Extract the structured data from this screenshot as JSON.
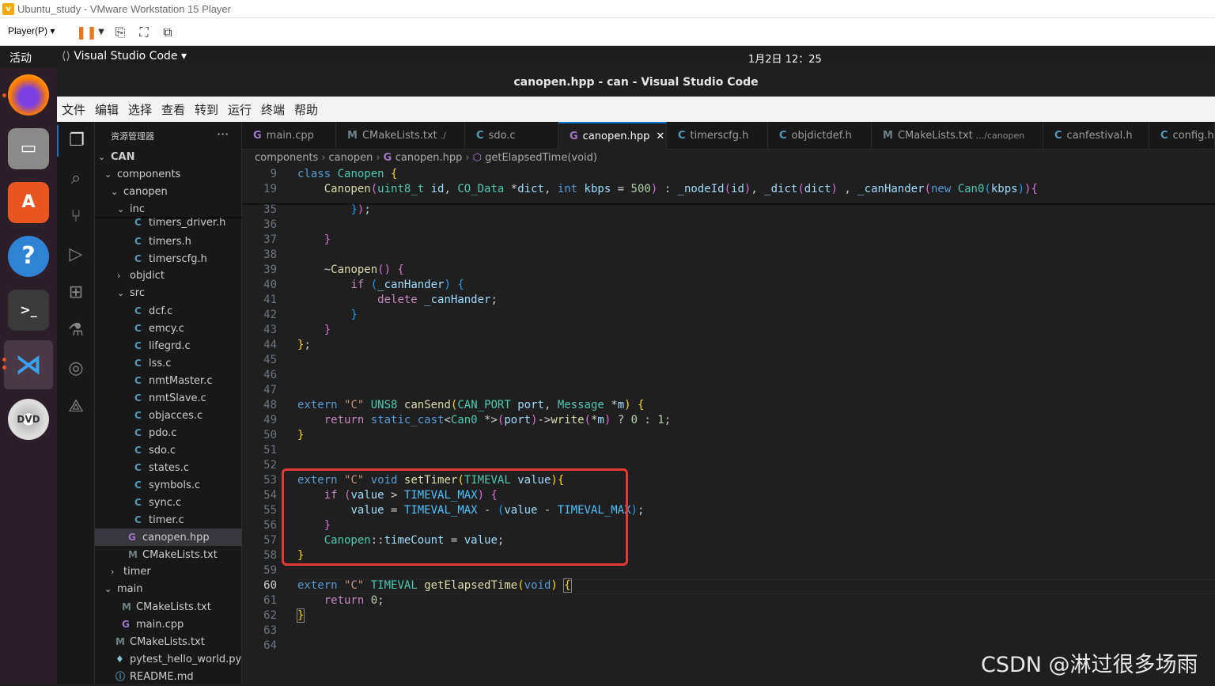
{
  "vm": {
    "title": "Ubuntu_study - VMware Workstation 15 Player",
    "player_menu": "Player(P)"
  },
  "gnome": {
    "activities": "活动",
    "app_name": "Visual Studio Code",
    "clock": "1月2日  12：25"
  },
  "vscode": {
    "title": "canopen.hpp - can - Visual Studio Code",
    "menu": [
      "文件",
      "编辑",
      "选择",
      "查看",
      "转到",
      "运行",
      "终端",
      "帮助"
    ]
  },
  "sidebar": {
    "header": "资源管理器",
    "more": "···",
    "tree": [
      {
        "label": "CAN",
        "depth": 0,
        "chev": "v",
        "icon": ""
      },
      {
        "label": "components",
        "depth": 1,
        "chev": "v",
        "icon": ""
      },
      {
        "label": "canopen",
        "depth": 2,
        "chev": "v",
        "icon": ""
      },
      {
        "label": "inc",
        "depth": 3,
        "chev": "v",
        "icon": ""
      },
      {
        "label": "timers_driver.h",
        "depth": 4,
        "chev": "",
        "icon": "C"
      },
      {
        "label": "timers.h",
        "depth": 4,
        "chev": "",
        "icon": "C"
      },
      {
        "label": "timerscfg.h",
        "depth": 4,
        "chev": "",
        "icon": "C"
      },
      {
        "label": "objdict",
        "depth": 3,
        "chev": ">",
        "icon": ""
      },
      {
        "label": "src",
        "depth": 3,
        "chev": "v",
        "icon": ""
      },
      {
        "label": "dcf.c",
        "depth": 4,
        "chev": "",
        "icon": "C"
      },
      {
        "label": "emcy.c",
        "depth": 4,
        "chev": "",
        "icon": "C"
      },
      {
        "label": "lifegrd.c",
        "depth": 4,
        "chev": "",
        "icon": "C"
      },
      {
        "label": "lss.c",
        "depth": 4,
        "chev": "",
        "icon": "C"
      },
      {
        "label": "nmtMaster.c",
        "depth": 4,
        "chev": "",
        "icon": "C"
      },
      {
        "label": "nmtSlave.c",
        "depth": 4,
        "chev": "",
        "icon": "C"
      },
      {
        "label": "objacces.c",
        "depth": 4,
        "chev": "",
        "icon": "C"
      },
      {
        "label": "pdo.c",
        "depth": 4,
        "chev": "",
        "icon": "C"
      },
      {
        "label": "sdo.c",
        "depth": 4,
        "chev": "",
        "icon": "C"
      },
      {
        "label": "states.c",
        "depth": 4,
        "chev": "",
        "icon": "C"
      },
      {
        "label": "symbols.c",
        "depth": 4,
        "chev": "",
        "icon": "C"
      },
      {
        "label": "sync.c",
        "depth": 4,
        "chev": "",
        "icon": "C"
      },
      {
        "label": "timer.c",
        "depth": 4,
        "chev": "",
        "icon": "C"
      },
      {
        "label": "canopen.hpp",
        "depth": 3,
        "chev": "",
        "icon": "G",
        "selected": true
      },
      {
        "label": "CMakeLists.txt",
        "depth": 3,
        "chev": "",
        "icon": "M"
      },
      {
        "label": "timer",
        "depth": 2,
        "chev": ">",
        "icon": ""
      },
      {
        "label": "main",
        "depth": 1,
        "chev": "v",
        "icon": ""
      },
      {
        "label": "CMakeLists.txt",
        "depth": 2,
        "chev": "",
        "icon": "M"
      },
      {
        "label": "main.cpp",
        "depth": 2,
        "chev": "",
        "icon": "G"
      },
      {
        "label": "CMakeLists.txt",
        "depth": 1,
        "chev": "",
        "icon": "M"
      },
      {
        "label": "pytest_hello_world.py",
        "depth": 1,
        "chev": "",
        "icon": "P"
      },
      {
        "label": "README.md",
        "depth": 1,
        "chev": "",
        "icon": "i"
      }
    ]
  },
  "tabs": [
    {
      "label": "main.cpp",
      "icon": "G",
      "desc": "",
      "active": false
    },
    {
      "label": "CMakeLists.txt",
      "icon": "M",
      "desc": "./",
      "active": false
    },
    {
      "label": "sdo.c",
      "icon": "C",
      "desc": "",
      "active": false
    },
    {
      "label": "canopen.hpp",
      "icon": "G",
      "desc": "",
      "active": true
    },
    {
      "label": "timerscfg.h",
      "icon": "C",
      "desc": "",
      "active": false
    },
    {
      "label": "objdictdef.h",
      "icon": "C",
      "desc": "",
      "active": false
    },
    {
      "label": "CMakeLists.txt",
      "icon": "M",
      "desc": ".../canopen",
      "active": false
    },
    {
      "label": "canfestival.h",
      "icon": "C",
      "desc": "",
      "active": false
    },
    {
      "label": "config.h",
      "icon": "C",
      "desc": "",
      "active": false
    }
  ],
  "breadcrumb": [
    "components",
    "canopen",
    "canopen.hpp",
    "getElapsedTime(void)"
  ],
  "code": {
    "sticky": [
      {
        "ln": "9",
        "html": "<span class=\"k\">class</span> <span class=\"t\">Canopen</span> <span class=\"p\">{</span>"
      },
      {
        "ln": "19",
        "html": "    <span class=\"f\">Canopen</span><span class=\"p2\">(</span><span class=\"t\">uint8_t</span> <span class=\"v\">id</span>, <span class=\"t\">CO_Data</span> *<span class=\"v\">dict</span>, <span class=\"k\">int</span> <span class=\"v\">kbps</span> = <span class=\"n\">500</span><span class=\"p2\">)</span> : <span class=\"v\">_nodeId</span><span class=\"p2\">(</span><span class=\"v\">id</span><span class=\"p2\">)</span>, <span class=\"v\">_dict</span><span class=\"p2\">(</span><span class=\"v\">dict</span><span class=\"p2\">)</span> , <span class=\"v\">_canHander</span><span class=\"p2\">(</span><span class=\"k\">new</span> <span class=\"t\">Can0</span><span class=\"p3\">(</span><span class=\"v\">kbps</span><span class=\"p3\">)</span><span class=\"p2\">)</span><span class=\"p2\">{</span>"
      }
    ],
    "lines": [
      {
        "ln": "35",
        "html": "        <span class=\"p3\">}</span><span class=\"p2\">)</span>;"
      },
      {
        "ln": "36",
        "html": ""
      },
      {
        "ln": "37",
        "html": "    <span class=\"p2\">}</span>"
      },
      {
        "ln": "38",
        "html": ""
      },
      {
        "ln": "39",
        "html": "    ~<span class=\"f\">Canopen</span><span class=\"p2\">()</span> <span class=\"p2\">{</span>"
      },
      {
        "ln": "40",
        "html": "        <span class=\"c\">if</span> <span class=\"p3\">(</span><span class=\"v\">_canHander</span><span class=\"p3\">)</span> <span class=\"p3\">{</span>"
      },
      {
        "ln": "41",
        "html": "            <span class=\"c\">delete</span> <span class=\"v\">_canHander</span>;"
      },
      {
        "ln": "42",
        "html": "        <span class=\"p3\">}</span>"
      },
      {
        "ln": "43",
        "html": "    <span class=\"p2\">}</span>"
      },
      {
        "ln": "44",
        "html": "<span class=\"p\">}</span>;"
      },
      {
        "ln": "45",
        "html": ""
      },
      {
        "ln": "46",
        "html": ""
      },
      {
        "ln": "47",
        "html": ""
      },
      {
        "ln": "48",
        "html": "<span class=\"k\">extern</span> <span class=\"s\">\"C\"</span> <span class=\"t\">UNS8</span> <span class=\"f\">canSend</span><span class=\"p\">(</span><span class=\"t\">CAN_PORT</span> <span class=\"v\">port</span>, <span class=\"t\">Message</span> *<span class=\"v\">m</span><span class=\"p\">)</span> <span class=\"p\">{</span>"
      },
      {
        "ln": "49",
        "html": "    <span class=\"c\">return</span> <span class=\"k\">static_cast</span>&lt;<span class=\"t\">Can0</span> *&gt;<span class=\"p2\">(</span><span class=\"v\">port</span><span class=\"p2\">)</span>-&gt;<span class=\"f\">write</span><span class=\"p2\">(</span>*<span class=\"v\">m</span><span class=\"p2\">)</span> ? <span class=\"n\">0</span> : <span class=\"n\">1</span>;"
      },
      {
        "ln": "50",
        "html": "<span class=\"p\">}</span>"
      },
      {
        "ln": "51",
        "html": ""
      },
      {
        "ln": "52",
        "html": ""
      },
      {
        "ln": "53",
        "html": "<span class=\"k\">extern</span> <span class=\"s\">\"C\"</span> <span class=\"k\">void</span> <span class=\"f\">setTimer</span><span class=\"p\">(</span><span class=\"t\">TIMEVAL</span> <span class=\"v\">value</span><span class=\"p\">)</span><span class=\"p\">{</span>"
      },
      {
        "ln": "54",
        "html": "    <span class=\"c\">if</span> <span class=\"p2\">(</span><span class=\"v\">value</span> &gt; <span class=\"m\">TIMEVAL_MAX</span><span class=\"p2\">)</span> <span class=\"p2\">{</span>"
      },
      {
        "ln": "55",
        "html": "        <span class=\"v\">value</span> = <span class=\"m\">TIMEVAL_MAX</span> - <span class=\"p3\">(</span><span class=\"v\">value</span> - <span class=\"m\">TIMEVAL_MAX</span><span class=\"p3\">)</span>;"
      },
      {
        "ln": "56",
        "html": "    <span class=\"p2\">}</span>"
      },
      {
        "ln": "57",
        "html": "    <span class=\"t\">Canopen</span>::<span class=\"v\">timeCount</span> = <span class=\"v\">value</span>;"
      },
      {
        "ln": "58",
        "html": "<span class=\"p\">}</span>"
      },
      {
        "ln": "59",
        "html": ""
      },
      {
        "ln": "60",
        "html": "<span class=\"k\">extern</span> <span class=\"s\">\"C\"</span> <span class=\"t\">TIMEVAL</span> <span class=\"f\">getElapsedTime</span><span class=\"p\">(</span><span class=\"k\">void</span><span class=\"p\">)</span> <span class=\"p\" style=\"outline:1px solid #888\">{</span>",
        "current": true
      },
      {
        "ln": "61",
        "html": "    <span class=\"c\">return</span> <span class=\"n\">0</span>;"
      },
      {
        "ln": "62",
        "html": "<span class=\"p\" style=\"outline:1px solid #888\">}</span>"
      },
      {
        "ln": "63",
        "html": ""
      },
      {
        "ln": "64",
        "html": ""
      }
    ]
  },
  "watermark": "CSDN @淋过很多场雨",
  "colors": {
    "accent": "#0078d4",
    "highlight": "#e53935"
  }
}
